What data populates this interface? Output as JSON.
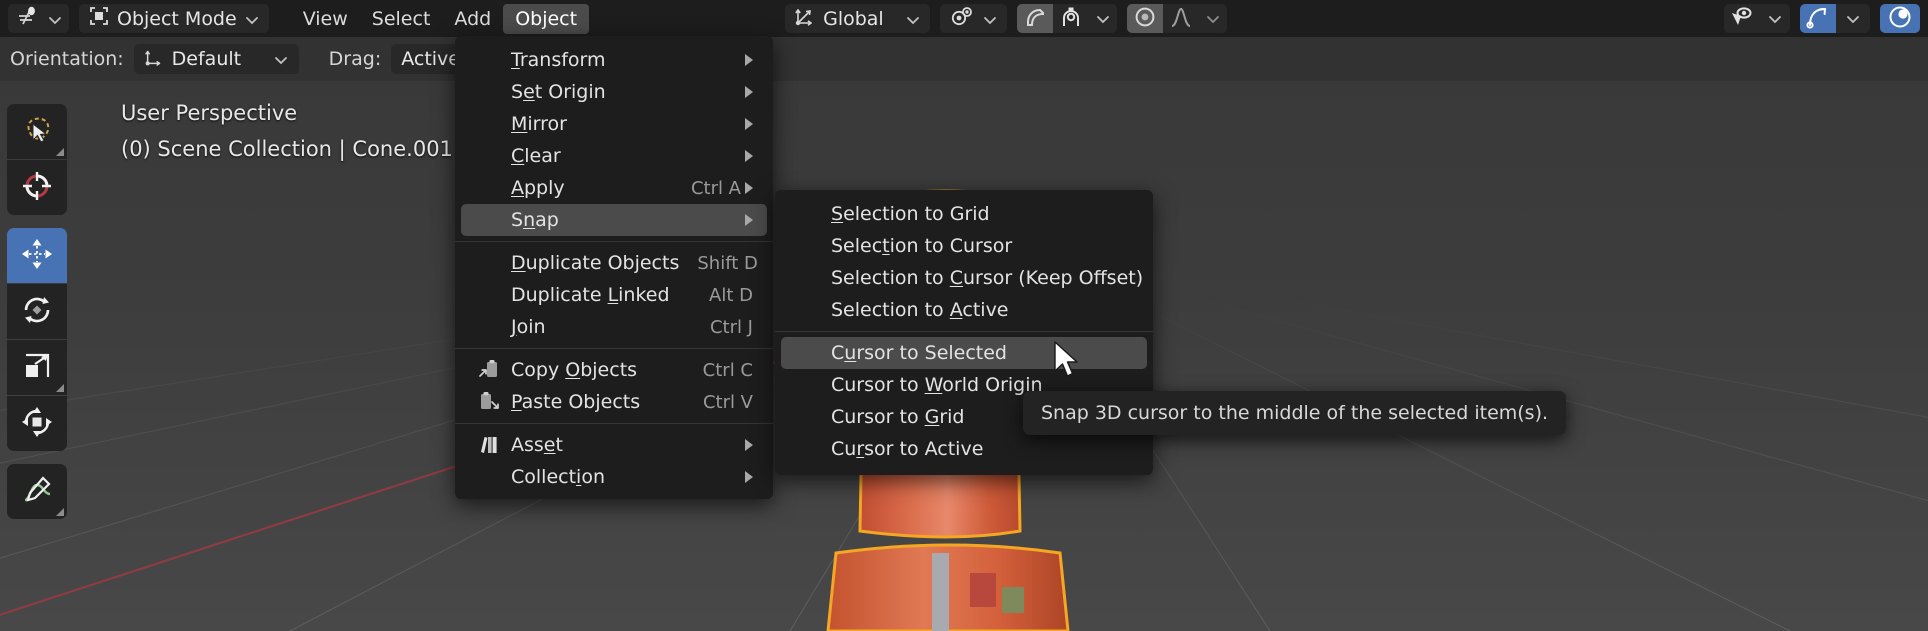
{
  "topbar": {
    "editor_type_icon": "editor-type-icon",
    "mode_label": "Object Mode",
    "menus": [
      "View",
      "Select",
      "Add",
      "Object"
    ],
    "active_menu": "Object",
    "transform_orientation_label": "Global",
    "transform_orientation_icon": "orientation-axes-icon",
    "pivot_icon": "pivot-point-icon",
    "snap_magnet_icon": "snap-magnet-icon",
    "snap_target_icon": "snap-vertex-icon",
    "proportional_edit_icon": "proportional-edit-icon",
    "proportional_falloff_icon": "falloff-curve-icon",
    "visibility_icon": "object-visibility-icon",
    "gizmo_icon": "gizmo-toggle-icon",
    "overlays_icon": "overlays-toggle-icon"
  },
  "toolrow": {
    "orientation_label": "Orientation:",
    "orientation_value": "Default",
    "orientation_icon": "orientation-axes-icon",
    "drag_label": "Drag:",
    "drag_value": "Active T..."
  },
  "viewport": {
    "perspective": "User Perspective",
    "collection_line": "(0) Scene Collection | Cone.001",
    "tools": [
      {
        "name": "tweak-select-box-tool",
        "icon": "cursor-lasso-icon",
        "selected": false
      },
      {
        "name": "cursor-tool",
        "icon": "3d-cursor-icon",
        "selected": false
      },
      {
        "name": "move-tool",
        "icon": "move-arrows-icon",
        "selected": true
      },
      {
        "name": "rotate-tool",
        "icon": "rotate-icon",
        "selected": false
      },
      {
        "name": "scale-tool",
        "icon": "scale-icon",
        "selected": false
      },
      {
        "name": "transform-tool",
        "icon": "transform-icon",
        "selected": false
      },
      {
        "name": "annotate-tool",
        "icon": "annotate-pencil-icon",
        "selected": false
      }
    ]
  },
  "object_menu": {
    "items": [
      {
        "label": "Transform",
        "accel": "T",
        "shortcut": "",
        "submenu": true,
        "icon": "",
        "highlight": false,
        "sep_after": false
      },
      {
        "label": "Set Origin",
        "accel": "e",
        "shortcut": "",
        "submenu": true,
        "icon": "",
        "highlight": false,
        "sep_after": false
      },
      {
        "label": "Mirror",
        "accel": "M",
        "shortcut": "",
        "submenu": true,
        "icon": "",
        "highlight": false,
        "sep_after": false
      },
      {
        "label": "Clear",
        "accel": "C",
        "shortcut": "",
        "submenu": true,
        "icon": "",
        "highlight": false,
        "sep_after": false
      },
      {
        "label": "Apply",
        "accel": "A",
        "shortcut": "Ctrl A",
        "submenu": true,
        "icon": "",
        "highlight": false,
        "sep_after": false
      },
      {
        "label": "Snap",
        "accel": "n",
        "shortcut": "",
        "submenu": true,
        "icon": "",
        "highlight": true,
        "sep_after": true
      },
      {
        "label": "Duplicate Objects",
        "accel": "D",
        "shortcut": "Shift D",
        "submenu": false,
        "icon": "",
        "highlight": false,
        "sep_after": false
      },
      {
        "label": "Duplicate Linked",
        "accel": "L",
        "shortcut": "Alt D",
        "submenu": false,
        "icon": "",
        "highlight": false,
        "sep_after": false
      },
      {
        "label": "Join",
        "accel": "J",
        "shortcut": "Ctrl J",
        "submenu": false,
        "icon": "",
        "highlight": false,
        "sep_after": true
      },
      {
        "label": "Copy Objects",
        "accel": "O",
        "shortcut": "Ctrl C",
        "submenu": false,
        "icon": "copy-clipboard-icon",
        "highlight": false,
        "sep_after": false
      },
      {
        "label": "Paste Objects",
        "accel": "P",
        "shortcut": "Ctrl V",
        "submenu": false,
        "icon": "paste-clipboard-icon",
        "highlight": false,
        "sep_after": true
      },
      {
        "label": "Asset",
        "accel": "e",
        "shortcut": "",
        "submenu": true,
        "icon": "asset-library-icon",
        "highlight": false,
        "sep_after": false
      },
      {
        "label": "Collection",
        "accel": "i",
        "shortcut": "",
        "submenu": true,
        "icon": "",
        "highlight": false,
        "sep_after": true
      }
    ]
  },
  "snap_submenu": {
    "items": [
      {
        "label": "Selection to Grid",
        "accel": "S",
        "highlight": false,
        "sep_after": false
      },
      {
        "label": "Selection to Cursor",
        "accel": "t",
        "highlight": false,
        "sep_after": false
      },
      {
        "label": "Selection to Cursor (Keep Offset)",
        "accel": "C",
        "highlight": false,
        "sep_after": false
      },
      {
        "label": "Selection to Active",
        "accel": "A",
        "highlight": false,
        "sep_after": true
      },
      {
        "label": "Cursor to Selected",
        "accel": "u",
        "highlight": true,
        "sep_after": false
      },
      {
        "label": "Cursor to World Origin",
        "accel": "W",
        "highlight": false,
        "sep_after": false
      },
      {
        "label": "Cursor to Grid",
        "accel": "G",
        "highlight": false,
        "sep_after": false
      },
      {
        "label": "Cursor to Active",
        "accel": "r",
        "highlight": false,
        "sep_after": false
      }
    ]
  },
  "tooltip": {
    "text": "Snap 3D cursor to the middle of the selected item(s)."
  },
  "colors": {
    "accent_blue": "#4772b3",
    "menu_bg": "#1d1d1d",
    "highlight": "#4b4b4b",
    "viewport_bg": "#3b3b3b",
    "object_orange": "#d4613c",
    "object_outline": "#f5a623",
    "axis_x_red": "#9b3a44"
  }
}
